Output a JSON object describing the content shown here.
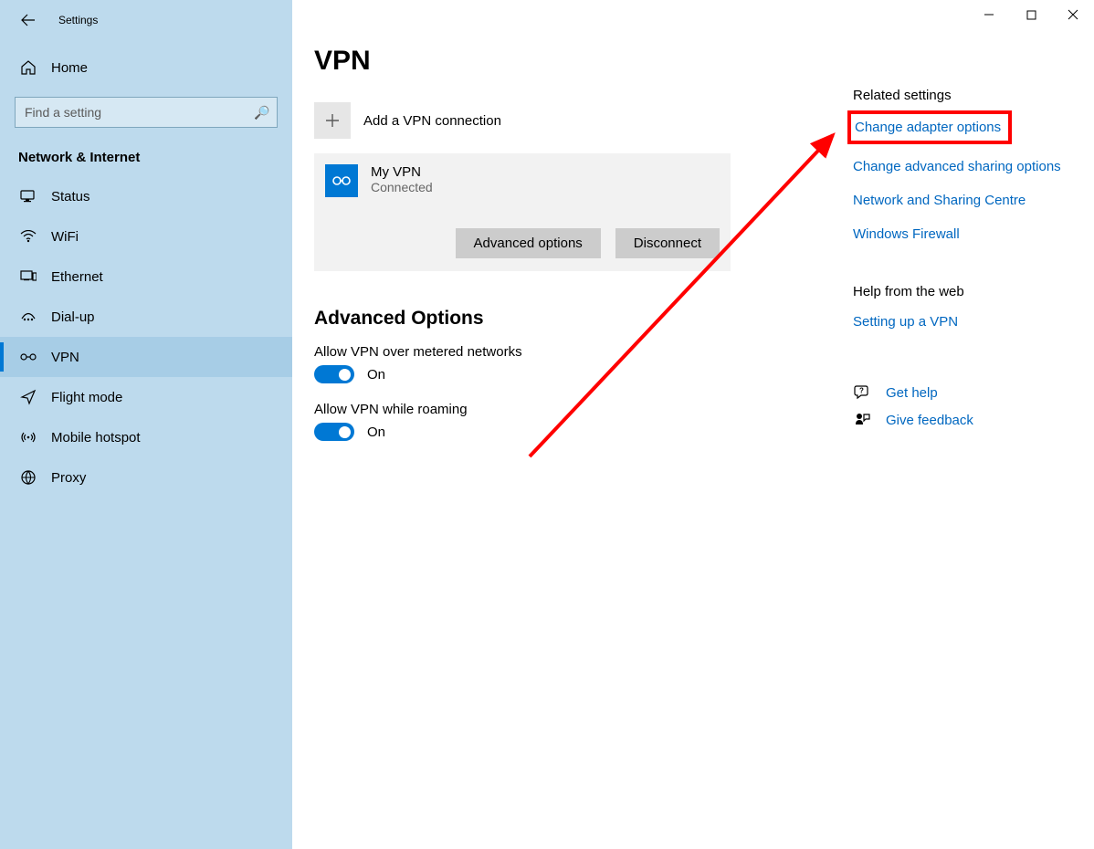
{
  "window": {
    "app_title": "Settings"
  },
  "sidebar": {
    "home": "Home",
    "search_placeholder": "Find a setting",
    "section": "Network & Internet",
    "items": [
      {
        "label": "Status"
      },
      {
        "label": "WiFi"
      },
      {
        "label": "Ethernet"
      },
      {
        "label": "Dial-up"
      },
      {
        "label": "VPN"
      },
      {
        "label": "Flight mode"
      },
      {
        "label": "Mobile hotspot"
      },
      {
        "label": "Proxy"
      }
    ]
  },
  "main": {
    "title": "VPN",
    "add": "Add a VPN connection",
    "vpn": {
      "name": "My VPN",
      "status": "Connected",
      "btn_adv": "Advanced options",
      "btn_dis": "Disconnect"
    },
    "adv": {
      "heading": "Advanced Options",
      "opt1": "Allow VPN over metered networks",
      "state1": "On",
      "opt2": "Allow VPN while roaming",
      "state2": "On"
    }
  },
  "rail": {
    "related": "Related settings",
    "links": [
      "Change adapter options",
      "Change advanced sharing options",
      "Network and Sharing Centre",
      "Windows Firewall"
    ],
    "help_heading": "Help from the web",
    "help_link": "Setting up a VPN",
    "get_help": "Get help",
    "feedback": "Give feedback"
  }
}
